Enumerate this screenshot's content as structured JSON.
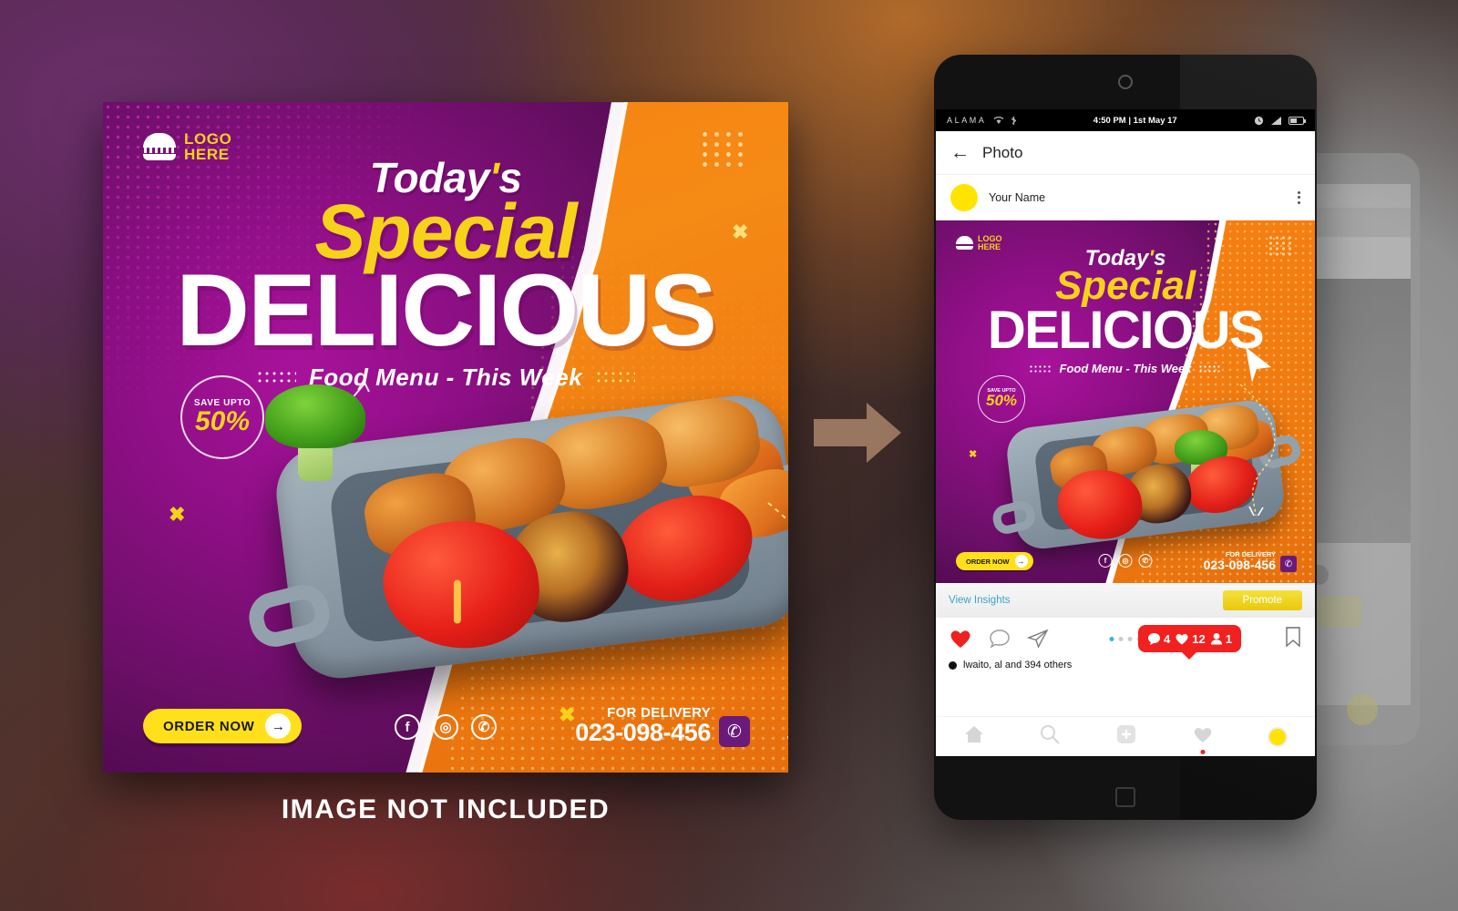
{
  "background": {
    "caption": "IMAGE NOT INCLUDED",
    "arrow_icon": "right-arrow",
    "colors": {
      "purple": "#6b2f6b",
      "brown": "#b06a2a",
      "grey": "#9b9b9b",
      "maroon": "#7a1f1f"
    }
  },
  "poster": {
    "logo": {
      "icon": "burger-logo-icon",
      "line1": "LOGO",
      "line2": "HERE"
    },
    "headline": {
      "today": "Today",
      "apostrophe": "'",
      "today_tail": "s",
      "special": "Special",
      "delicious": "DELICIOUS",
      "subtitle": "Food Menu - This Week"
    },
    "save_badge": {
      "label": "SAVE UPTO",
      "value": "50%"
    },
    "order_button": {
      "label": "ORDER NOW",
      "arrow": "→"
    },
    "socials": [
      {
        "name": "facebook-icon",
        "glyph": "f"
      },
      {
        "name": "instagram-icon",
        "glyph": "◎"
      },
      {
        "name": "whatsapp-icon",
        "glyph": "✆"
      }
    ],
    "delivery": {
      "label": "FOR DELIVERY",
      "phone": "023-098-456",
      "icon": "phone-icon"
    },
    "colors": {
      "purple": "#a8129b",
      "orange": "#f98012",
      "yellow": "#f7d21a",
      "button": "#ffe01b"
    }
  },
  "phone": {
    "statusbar": {
      "carrier": "ALAMA",
      "wifi_icon": "wifi-icon",
      "bluetooth_icon": "bluetooth-icon",
      "time": "4:50 PM | 1st May 17",
      "clock_icon": "clock-icon",
      "signal_icon": "signal-icon",
      "battery_icon": "battery-icon"
    },
    "app_header": {
      "back_icon": "back-arrow-icon",
      "title": "Photo"
    },
    "user_row": {
      "avatar": "user-avatar",
      "name": "Your Name",
      "menu_icon": "kebab-menu-icon"
    },
    "insights": {
      "label": "View Insights",
      "promote": "Promote"
    },
    "actions": {
      "like_icon": "heart-icon",
      "comment_icon": "comment-icon",
      "share_icon": "share-icon",
      "bookmark_icon": "bookmark-icon"
    },
    "notification": {
      "comments_icon": "comment-bubble-icon",
      "comments": "4",
      "likes_icon": "heart-icon",
      "likes": "12",
      "follower_icon": "person-icon",
      "followers": "1"
    },
    "likes_text": "lwaito, al  and 394 others",
    "navbar": [
      {
        "name": "nav-home-icon",
        "label": "home"
      },
      {
        "name": "nav-search-icon",
        "label": "search"
      },
      {
        "name": "nav-add-icon",
        "label": "add"
      },
      {
        "name": "nav-activity-icon",
        "label": "activity"
      },
      {
        "name": "nav-profile-avatar",
        "label": "profile"
      }
    ],
    "home_button": "home-square-button"
  }
}
